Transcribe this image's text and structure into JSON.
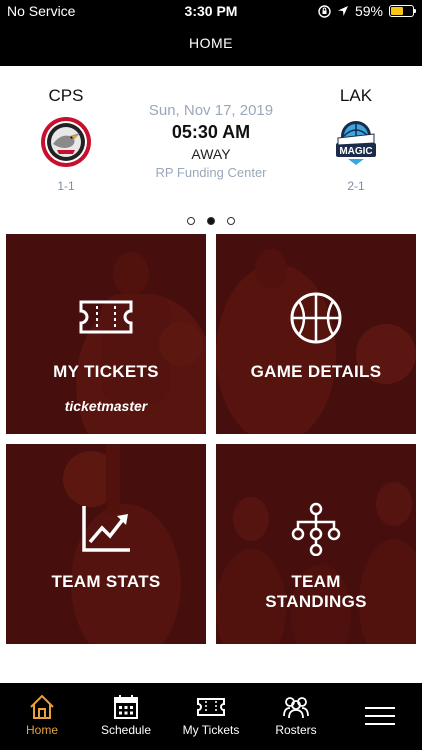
{
  "status_bar": {
    "carrier": "No Service",
    "time": "3:30 PM",
    "battery": "59%",
    "battery_level": 0.59
  },
  "nav": {
    "title": "HOME"
  },
  "game": {
    "home_team": {
      "abbr": "CPS",
      "record": "1-1",
      "logo_text": "COLLEGE PARK SKYHAWKS"
    },
    "away_team": {
      "abbr": "LAK",
      "record": "2-1",
      "logo_text_top": "LAKELAND",
      "logo_text_main": "MAGIC"
    },
    "date": "Sun, Nov 17, 2019",
    "time": "05:30 AM",
    "location": "AWAY",
    "venue": "RP Funding Center"
  },
  "pager": {
    "count": 3,
    "active_index": 1
  },
  "tiles": [
    {
      "label_line1": "MY TICKETS",
      "label_line2": "",
      "brand": "ticketmaster",
      "icon": "ticket-icon"
    },
    {
      "label_line1": "GAME DETAILS",
      "label_line2": "",
      "brand": "",
      "icon": "basketball-icon"
    },
    {
      "label_line1": "TEAM STATS",
      "label_line2": "",
      "brand": "",
      "icon": "chart-icon"
    },
    {
      "label_line1": "TEAM",
      "label_line2": "STANDINGS",
      "brand": "",
      "icon": "hierarchy-icon"
    }
  ],
  "tab_bar": {
    "items": [
      {
        "label": "Home",
        "icon": "home-icon",
        "active": true
      },
      {
        "label": "Schedule",
        "icon": "calendar-icon",
        "active": false
      },
      {
        "label": "My Tickets",
        "icon": "ticket-icon",
        "active": false
      },
      {
        "label": "Rosters",
        "icon": "people-icon",
        "active": false
      },
      {
        "label": "",
        "icon": "menu-icon",
        "active": false
      }
    ]
  },
  "colors": {
    "accent": "#e6a23c",
    "tile_tint": "#5e1410",
    "muted_text": "#9aa8bb"
  }
}
